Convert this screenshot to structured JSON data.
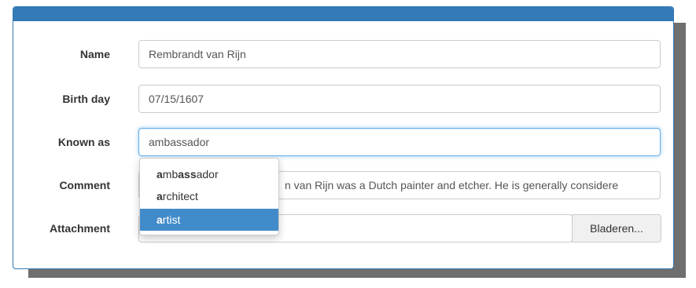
{
  "form": {
    "name": {
      "label": "Name",
      "value": "Rembrandt van Rijn"
    },
    "birthday": {
      "label": "Birth day",
      "value": "07/15/1607"
    },
    "known_as": {
      "label": "Known as",
      "value": "ambassador"
    },
    "comment": {
      "label": "Comment",
      "visible_value": "n van Rijn was a Dutch painter and etcher. He is generally considere"
    },
    "attachment": {
      "label": "Attachment",
      "value": "",
      "browse_label": "Bladeren..."
    }
  },
  "autocomplete": {
    "query": "a",
    "items": [
      {
        "match": "a",
        "bold2": "",
        "rest": "mb",
        "ass": "ass",
        "tail": "ador",
        "full": "ambassador",
        "active": false
      },
      {
        "match": "a",
        "rest": "rchitect",
        "full": "architect",
        "active": false
      },
      {
        "match": "a",
        "rest": "rtist",
        "full": "artist",
        "active": true
      }
    ]
  },
  "colors": {
    "accent": "#337ab7",
    "highlight": "#428bca",
    "focus": "#66afe9"
  }
}
